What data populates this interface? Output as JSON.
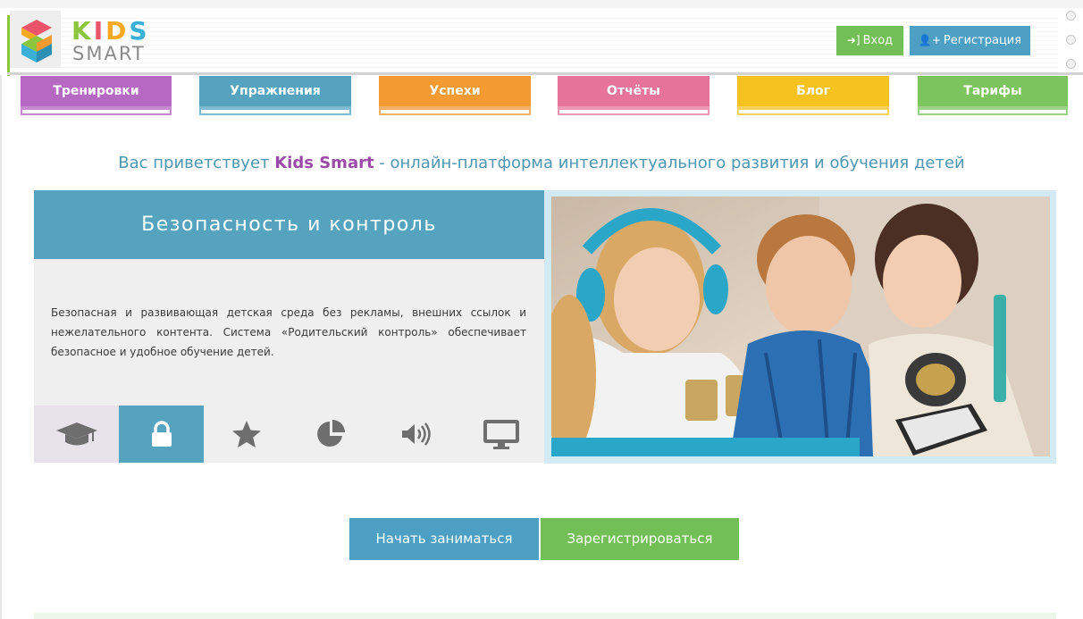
{
  "brand": {
    "kids_letters": [
      "K",
      "I",
      "D",
      "S"
    ],
    "smart": "SMART",
    "colors": {
      "k": "#8cc63f",
      "i": "#e9546b",
      "d": "#f7a922",
      "s": "#3ab0d6",
      "smart": "#8a8a8a"
    }
  },
  "header": {
    "login_icon": "sign-in-icon",
    "login_label": "Вход",
    "register_icon": "user-plus-icon",
    "register_label": "Регистрация"
  },
  "nav": {
    "tabs": [
      {
        "label": "Тренировки",
        "color": "#b569c2",
        "border": "#c78ad1"
      },
      {
        "label": "Упражнения",
        "color": "#56a3bf",
        "border": "#7dbbd2"
      },
      {
        "label": "Успехи",
        "color": "#f39a33",
        "border": "#f5b168"
      },
      {
        "label": "Отчёты",
        "color": "#e5739a",
        "border": "#ec97b4"
      },
      {
        "label": "Блог",
        "color": "#f5c21f",
        "border": "#f7d25a"
      },
      {
        "label": "Тарифы",
        "color": "#7cc45e",
        "border": "#9dd386"
      }
    ]
  },
  "welcome": {
    "prefix": "Вас приветствует ",
    "brand": "Kids Smart",
    "suffix": " - онлайн-платформа интеллектуального развития и обучения детей"
  },
  "feature": {
    "title": "Безопасность и контроль",
    "text": "Безопасная и развивающая детская среда без рекламы, внешних ссылок и нежелательного контента. Система «Родительский контроль» обеспечивает безопасное и удобное обучение детей.",
    "icons": [
      "graduation-cap-icon",
      "lock-icon",
      "star-icon",
      "pie-chart-icon",
      "volume-icon",
      "monitor-icon"
    ],
    "active_index": 1
  },
  "cta": {
    "start_label": "Начать заниматься",
    "register_label": "Зарегистрироваться"
  }
}
